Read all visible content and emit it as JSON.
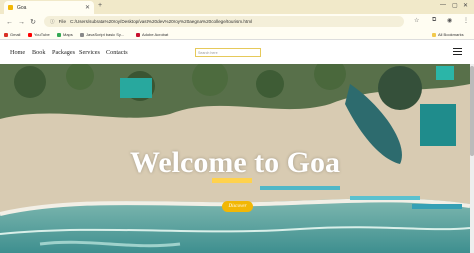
{
  "browser": {
    "tab_title": "Goa",
    "url_prefix": "File",
    "url": "C:/Users/subrata%20roy/Desktop/vast%20dev%20roy%20aegna%20college/tourism.html",
    "bookmarks": [
      {
        "label": "Gmail",
        "color": "#d93025"
      },
      {
        "label": "YouTube",
        "color": "#ff0000"
      },
      {
        "label": "Maps",
        "color": "#34a853"
      },
      {
        "label": "JavaScript basic Sy...",
        "color": "#888888"
      },
      {
        "label": "Adobe Acrobat",
        "color": "#c8102e"
      }
    ],
    "all_bookmarks": "All Bookmarks"
  },
  "site": {
    "nav": [
      "Home",
      "Book",
      "Packages",
      "Services",
      "Contacts"
    ],
    "search_placeholder": "Search here"
  },
  "hero": {
    "title": "Welcome to Goa",
    "button": "Discover"
  }
}
